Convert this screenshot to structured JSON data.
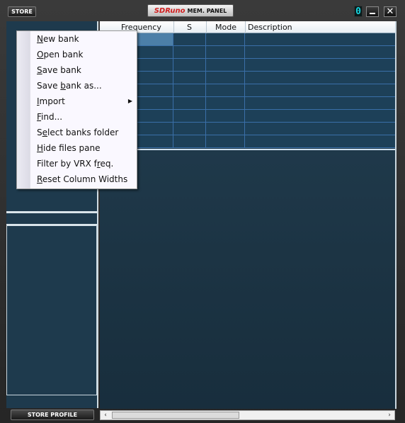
{
  "title_bar": {
    "store_label": "STORE",
    "logo_brand": "SDRuno",
    "logo_panel": "MEM.  PANEL",
    "digit": "0",
    "close_glyph": "✕"
  },
  "grid": {
    "columns": [
      "Frequency",
      "S",
      "Mode",
      "Description"
    ]
  },
  "left_pane": {
    "store_profile_label": "STORE PROFILE"
  },
  "scrollbar": {
    "left_arrow": "‹",
    "right_arrow": "›"
  },
  "context_menu": {
    "items": [
      {
        "mnemonic": "N",
        "rest": "ew bank",
        "submenu": false
      },
      {
        "mnemonic": "O",
        "rest": "pen bank",
        "submenu": false
      },
      {
        "mnemonic": "S",
        "rest": "ave bank",
        "submenu": false
      },
      {
        "pre": "Save ",
        "mnemonic": "b",
        "rest": "ank as...",
        "submenu": false
      },
      {
        "mnemonic": "I",
        "rest": "mport",
        "submenu": true
      },
      {
        "mnemonic": "F",
        "rest": "ind...",
        "submenu": false
      },
      {
        "pre": "S",
        "mnemonic": "e",
        "rest": "lect banks folder",
        "submenu": false
      },
      {
        "mnemonic": "H",
        "rest": "ide files pane",
        "submenu": false
      },
      {
        "pre": "Filter by VRX f",
        "mnemonic": "r",
        "rest": "eq.",
        "submenu": false
      },
      {
        "mnemonic": "R",
        "rest": "eset Column Widths",
        "submenu": false
      }
    ]
  },
  "colors": {
    "accent_cyan": "#17d6e0",
    "brand_red": "#d21f1f",
    "selection": "#4c7fa8",
    "grid_bg": "#1d4058"
  }
}
